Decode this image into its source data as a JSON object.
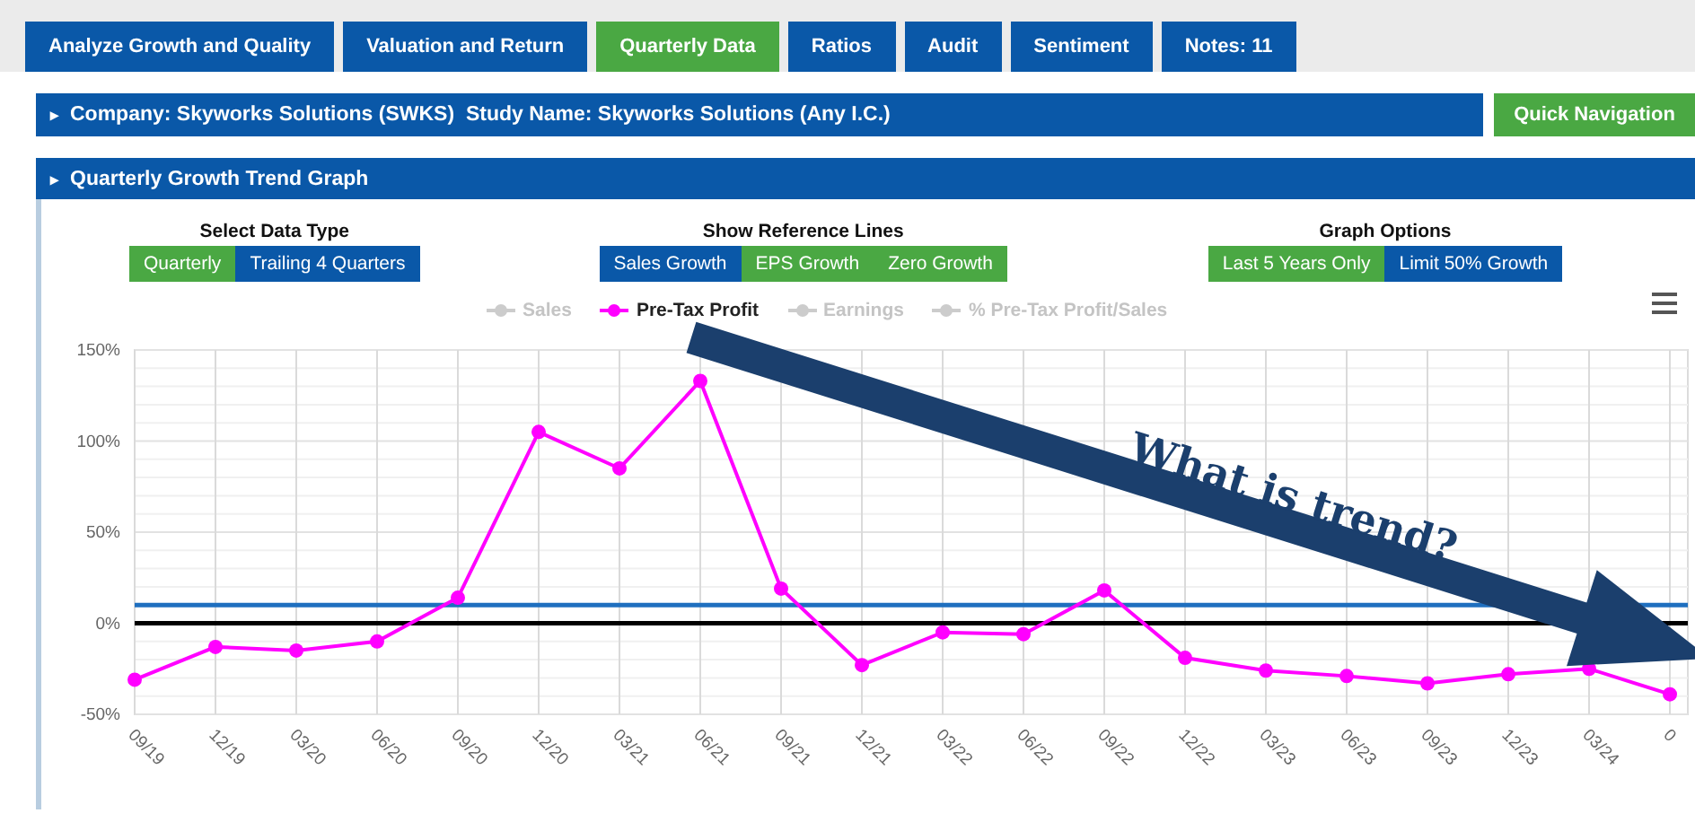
{
  "tabs": [
    {
      "label": "Analyze Growth and Quality",
      "selected": false
    },
    {
      "label": "Valuation and Return",
      "selected": false
    },
    {
      "label": "Quarterly Data",
      "selected": true
    },
    {
      "label": "Ratios",
      "selected": false
    },
    {
      "label": "Audit",
      "selected": false
    },
    {
      "label": "Sentiment",
      "selected": false
    },
    {
      "label": "Notes: 11",
      "selected": false
    }
  ],
  "company_bar": {
    "arrow": "▸",
    "text": "Company: Skyworks Solutions (SWKS)  Study Name: Skyworks Solutions (Any I.C.)"
  },
  "quick_navigation": {
    "label": "Quick Navigation"
  },
  "graph_panel": {
    "arrow": "▸",
    "title": "Quarterly Growth Trend Graph",
    "option_groups": [
      {
        "title": "Select Data Type",
        "buttons": [
          {
            "label": "Quarterly",
            "selected": true
          },
          {
            "label": "Trailing 4 Quarters",
            "selected": false
          }
        ]
      },
      {
        "title": "Show Reference Lines",
        "buttons": [
          {
            "label": "Sales Growth",
            "selected": false
          },
          {
            "label": "EPS Growth",
            "selected": true
          },
          {
            "label": "Zero Growth",
            "selected": true
          }
        ]
      },
      {
        "title": "Graph Options",
        "buttons": [
          {
            "label": "Last 5 Years Only",
            "selected": true
          },
          {
            "label": "Limit 50% Growth",
            "selected": false
          }
        ]
      }
    ],
    "legend": [
      {
        "label": "Sales",
        "visible": false
      },
      {
        "kind": "series",
        "visible": true
      },
      {
        "label": "Earnings",
        "visible": false
      },
      {
        "label": "% Pre-Tax Profit/Sales",
        "visible": false
      }
    ],
    "chart_data": {
      "type": "line",
      "categories": [
        "09/19",
        "12/19",
        "03/20",
        "06/20",
        "09/20",
        "12/20",
        "03/21",
        "06/21",
        "09/21",
        "12/21",
        "03/22",
        "06/22",
        "09/22",
        "12/22",
        "03/23",
        "06/23",
        "09/23",
        "12/23",
        "03/24",
        "0"
      ],
      "series": [
        {
          "name": "Pre-Tax Profit",
          "color": "#ff00ff",
          "marker": "circle",
          "values": [
            -31,
            -13,
            -15,
            -10,
            14,
            105,
            85,
            133,
            19,
            -23,
            -5,
            -6,
            18,
            -19,
            -26,
            -29,
            -33,
            -28,
            -25,
            -39
          ]
        }
      ],
      "ylim": [
        -50,
        150
      ],
      "yticks": [
        {
          "value": -50,
          "label": "-50%"
        },
        {
          "value": 0,
          "label": "0%"
        },
        {
          "value": 50,
          "label": "50%"
        },
        {
          "value": 100,
          "label": "100%"
        },
        {
          "value": 150,
          "label": "150%"
        }
      ],
      "grid": true,
      "ref_lines": [
        {
          "axis": "y",
          "value": 10,
          "color": "#1f6fbf"
        },
        {
          "axis": "y",
          "value": 0,
          "color": "#000000"
        }
      ]
    }
  },
  "overlay": {
    "text": "What is trend?"
  }
}
